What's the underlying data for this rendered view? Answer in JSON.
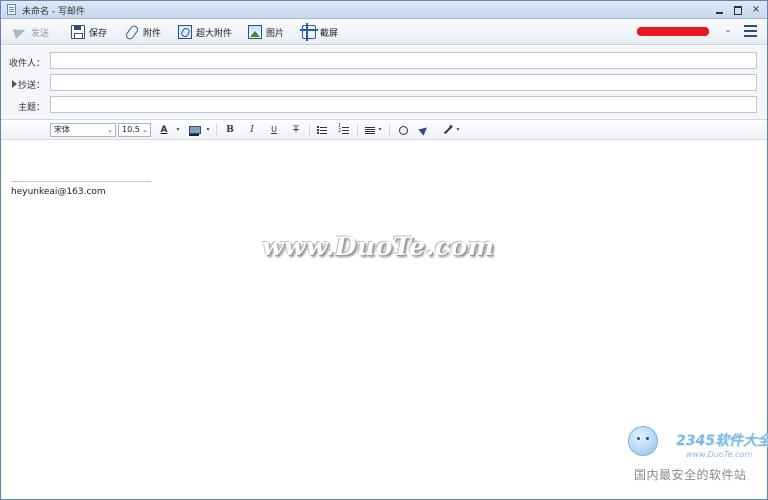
{
  "window": {
    "title": "未命名 - 写邮件",
    "min_label": "",
    "max_label": "",
    "close_label": "×"
  },
  "toolbar": {
    "send_label": "发送",
    "save_label": "保存",
    "attach_label": "附件",
    "big_attach_label": "超大附件",
    "image_label": "图片",
    "screenshot_label": "截屏",
    "account_label": "",
    "account_redaction_color": "#e8151b",
    "account_chevron": "⌄"
  },
  "fields": {
    "to_label": "收件人：",
    "to_value": "",
    "cc_label": "抄送：",
    "cc_value": "",
    "subject_label": "主题：",
    "subject_value": ""
  },
  "format": {
    "font_family": "宋体",
    "font_size": "10.5",
    "select_chevron": "⌄",
    "font_color_label": "A",
    "bold_label": "B",
    "italic_label": "I",
    "underline_label": "U",
    "strike_label": "T",
    "dropdown_glyph": "▾"
  },
  "body": {
    "signature": "heyunkeai@163.com"
  },
  "watermarks": {
    "main": "www.DuoTe.com",
    "corner_site": "2345软件大全",
    "corner_url": "www.DuoTe.com",
    "corner_slogan": "国内最安全的软件站"
  },
  "colors": {
    "accent": "#2f4f7a",
    "title_bar": "#c6d7ee",
    "border": "#5f86b3"
  }
}
